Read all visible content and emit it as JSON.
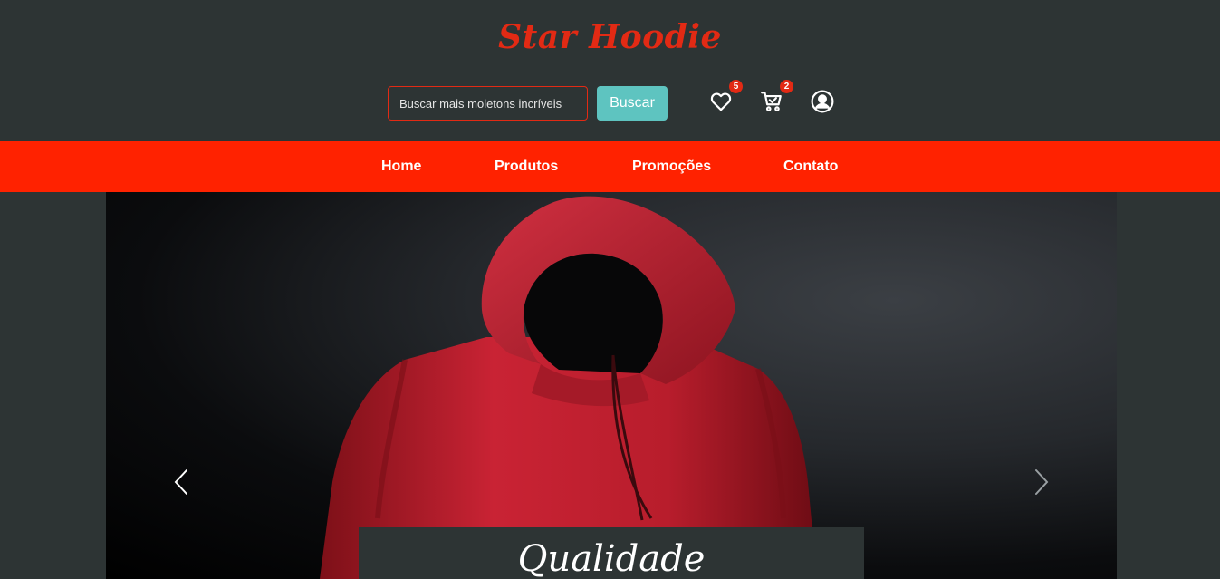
{
  "brand": {
    "name": "Star Hoodie"
  },
  "search": {
    "placeholder": "Buscar mais moletons incríveis",
    "button_label": "Buscar"
  },
  "header_icons": {
    "wishlist": {
      "icon": "heart-icon",
      "count": "5"
    },
    "cart": {
      "icon": "cart-icon",
      "count": "2"
    },
    "account": {
      "icon": "user-icon"
    }
  },
  "nav": {
    "items": [
      {
        "label": "Home"
      },
      {
        "label": "Produtos"
      },
      {
        "label": "Promoções"
      },
      {
        "label": "Contato"
      }
    ]
  },
  "hero": {
    "caption": "Qualidade",
    "prev_icon": "chevron-left-icon",
    "next_icon": "chevron-right-icon"
  },
  "colors": {
    "background": "#2d3434",
    "brand_red": "#e22a14",
    "nav_red": "#ff2200",
    "accent_teal": "#5ec4c0",
    "hoodie_red": "#c41f2c"
  }
}
